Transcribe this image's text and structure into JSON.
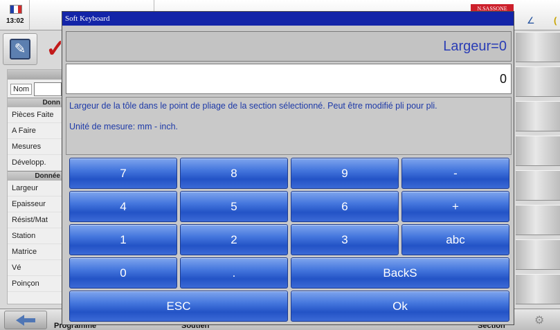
{
  "status": {
    "clock": "13:02",
    "brand": "N.SASSONE",
    "flag_colors": [
      "#1f3ea8",
      "#ffffff",
      "#d22b2b"
    ]
  },
  "left_panel": {
    "nom_label": "Nom",
    "section1_title": "Donn",
    "section1_items": [
      "Pièces Faite",
      "A Faire",
      "Mesures",
      "Développ."
    ],
    "section2_title": "Donnée",
    "section2_items": [
      "Largeur",
      "Epaisseur",
      "Résist/Mat",
      "Station",
      "Matrice",
      "Vé",
      "Poinçon"
    ]
  },
  "bottom_bar": {
    "labels": [
      "Programme",
      "Soutien",
      "Section"
    ]
  },
  "dialog": {
    "title": "Soft Keyboard",
    "field_title": "Largeur=0",
    "value": "0",
    "description": "Largeur de la tôle dans le point de pliage de la section sélectionné. Peut être modifié pli pour pli.",
    "unit_text": "Unité de mesure: mm - inch.",
    "keys": {
      "k7": "7",
      "k8": "8",
      "k9": "9",
      "minus": "-",
      "k4": "4",
      "k5": "5",
      "k6": "6",
      "plus": "+",
      "k1": "1",
      "k2": "2",
      "k3": "3",
      "abc": "abc",
      "k0": "0",
      "dot": ".",
      "backs": "BackS",
      "esc": "ESC",
      "ok": "Ok"
    }
  },
  "colors": {
    "title_bar": "#1324a8",
    "field_title_text": "#2a3db5",
    "info_text": "#1e3aa8",
    "key_blue": "#2353c6"
  }
}
